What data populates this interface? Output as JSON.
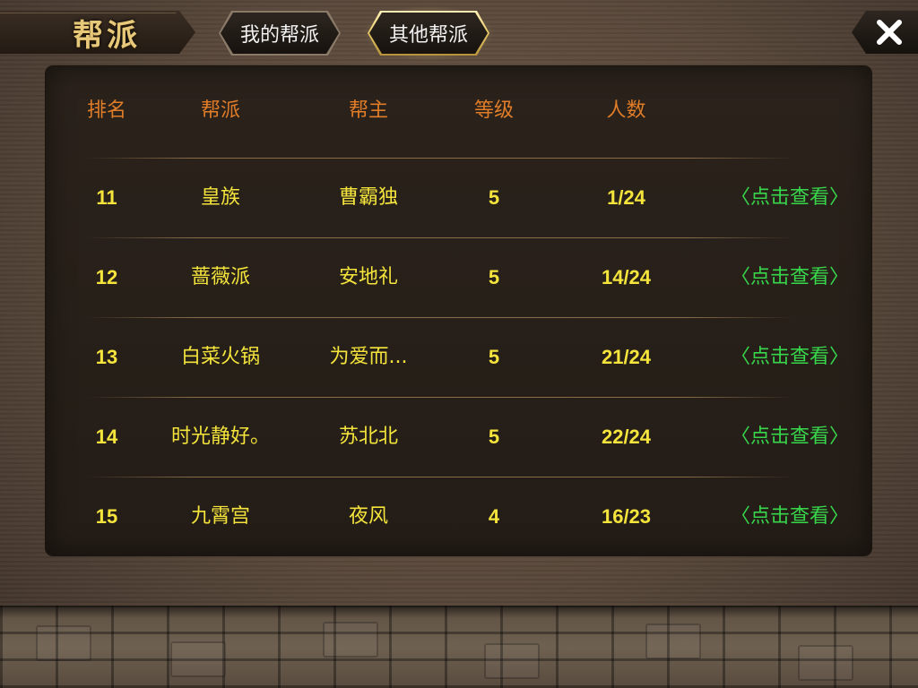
{
  "header": {
    "title": "帮派",
    "tabs": [
      {
        "label": "我的帮派",
        "active": false
      },
      {
        "label": "其他帮派",
        "active": true
      }
    ],
    "close_icon": "close-icon"
  },
  "table": {
    "columns": [
      "排名",
      "帮派",
      "帮主",
      "等级",
      "人数"
    ],
    "rows": [
      {
        "rank": "11",
        "guild": "皇族",
        "leader": "曹霸独",
        "level": "5",
        "members": "1/24",
        "action": "〈点击查看〉"
      },
      {
        "rank": "12",
        "guild": "蔷薇派",
        "leader": "安地礼",
        "level": "5",
        "members": "14/24",
        "action": "〈点击查看〉"
      },
      {
        "rank": "13",
        "guild": "白菜火锅",
        "leader": "为爱而...",
        "level": "5",
        "members": "21/24",
        "action": "〈点击查看〉"
      },
      {
        "rank": "14",
        "guild": "时光静好。",
        "leader": "苏北北",
        "level": "5",
        "members": "22/24",
        "action": "〈点击查看〉"
      },
      {
        "rank": "15",
        "guild": "九霄宫",
        "leader": "夜风",
        "level": "4",
        "members": "16/23",
        "action": "〈点击查看〉"
      }
    ]
  },
  "colors": {
    "header_text": "#e07d28",
    "value_text": "#f4e43c",
    "link_text": "#37d64b",
    "title_gold": "#e8c979"
  }
}
